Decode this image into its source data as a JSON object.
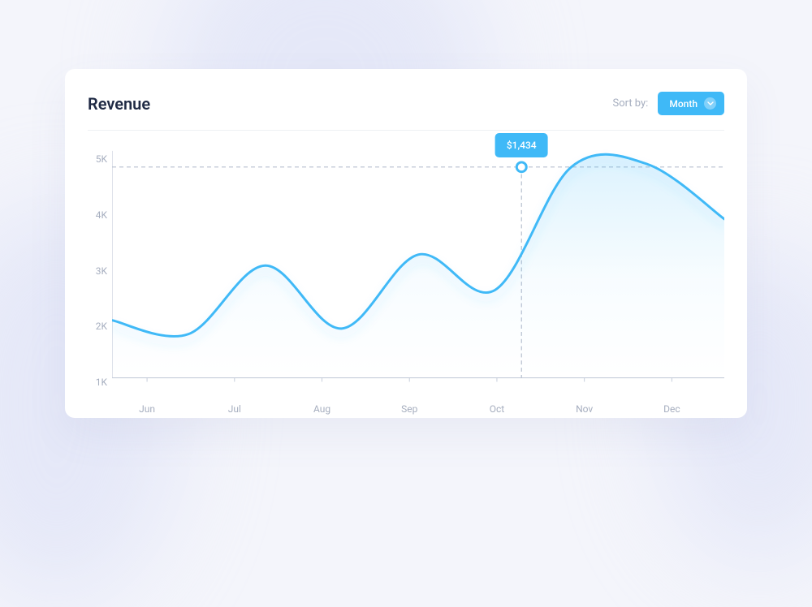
{
  "header": {
    "title": "Revenue",
    "sort_label": "Sort by:",
    "sort_value": "Month"
  },
  "tooltip": {
    "value": "$1,434"
  },
  "chart_data": {
    "type": "line",
    "title": "Revenue",
    "xlabel": "",
    "ylabel": "",
    "categories": [
      "Jun",
      "Jul",
      "Aug",
      "Sep",
      "Oct",
      "Nov",
      "Dec"
    ],
    "values": [
      2050,
      1800,
      3050,
      1900,
      3250,
      2600,
      4850,
      4900,
      3900
    ],
    "y_ticks": [
      "1K",
      "2K",
      "3K",
      "4K",
      "5K"
    ],
    "ylim": [
      1000,
      5000
    ],
    "highlight": {
      "index": 5.35,
      "value": 4850,
      "label": "$1,434"
    },
    "colors": {
      "line": "#3fb9f7",
      "fill_top": "rgba(63,185,247,0.14)",
      "fill_bottom": "rgba(63,185,247,0.0)",
      "axis": "#c7cedb",
      "dash": "#b7bfcf"
    }
  }
}
